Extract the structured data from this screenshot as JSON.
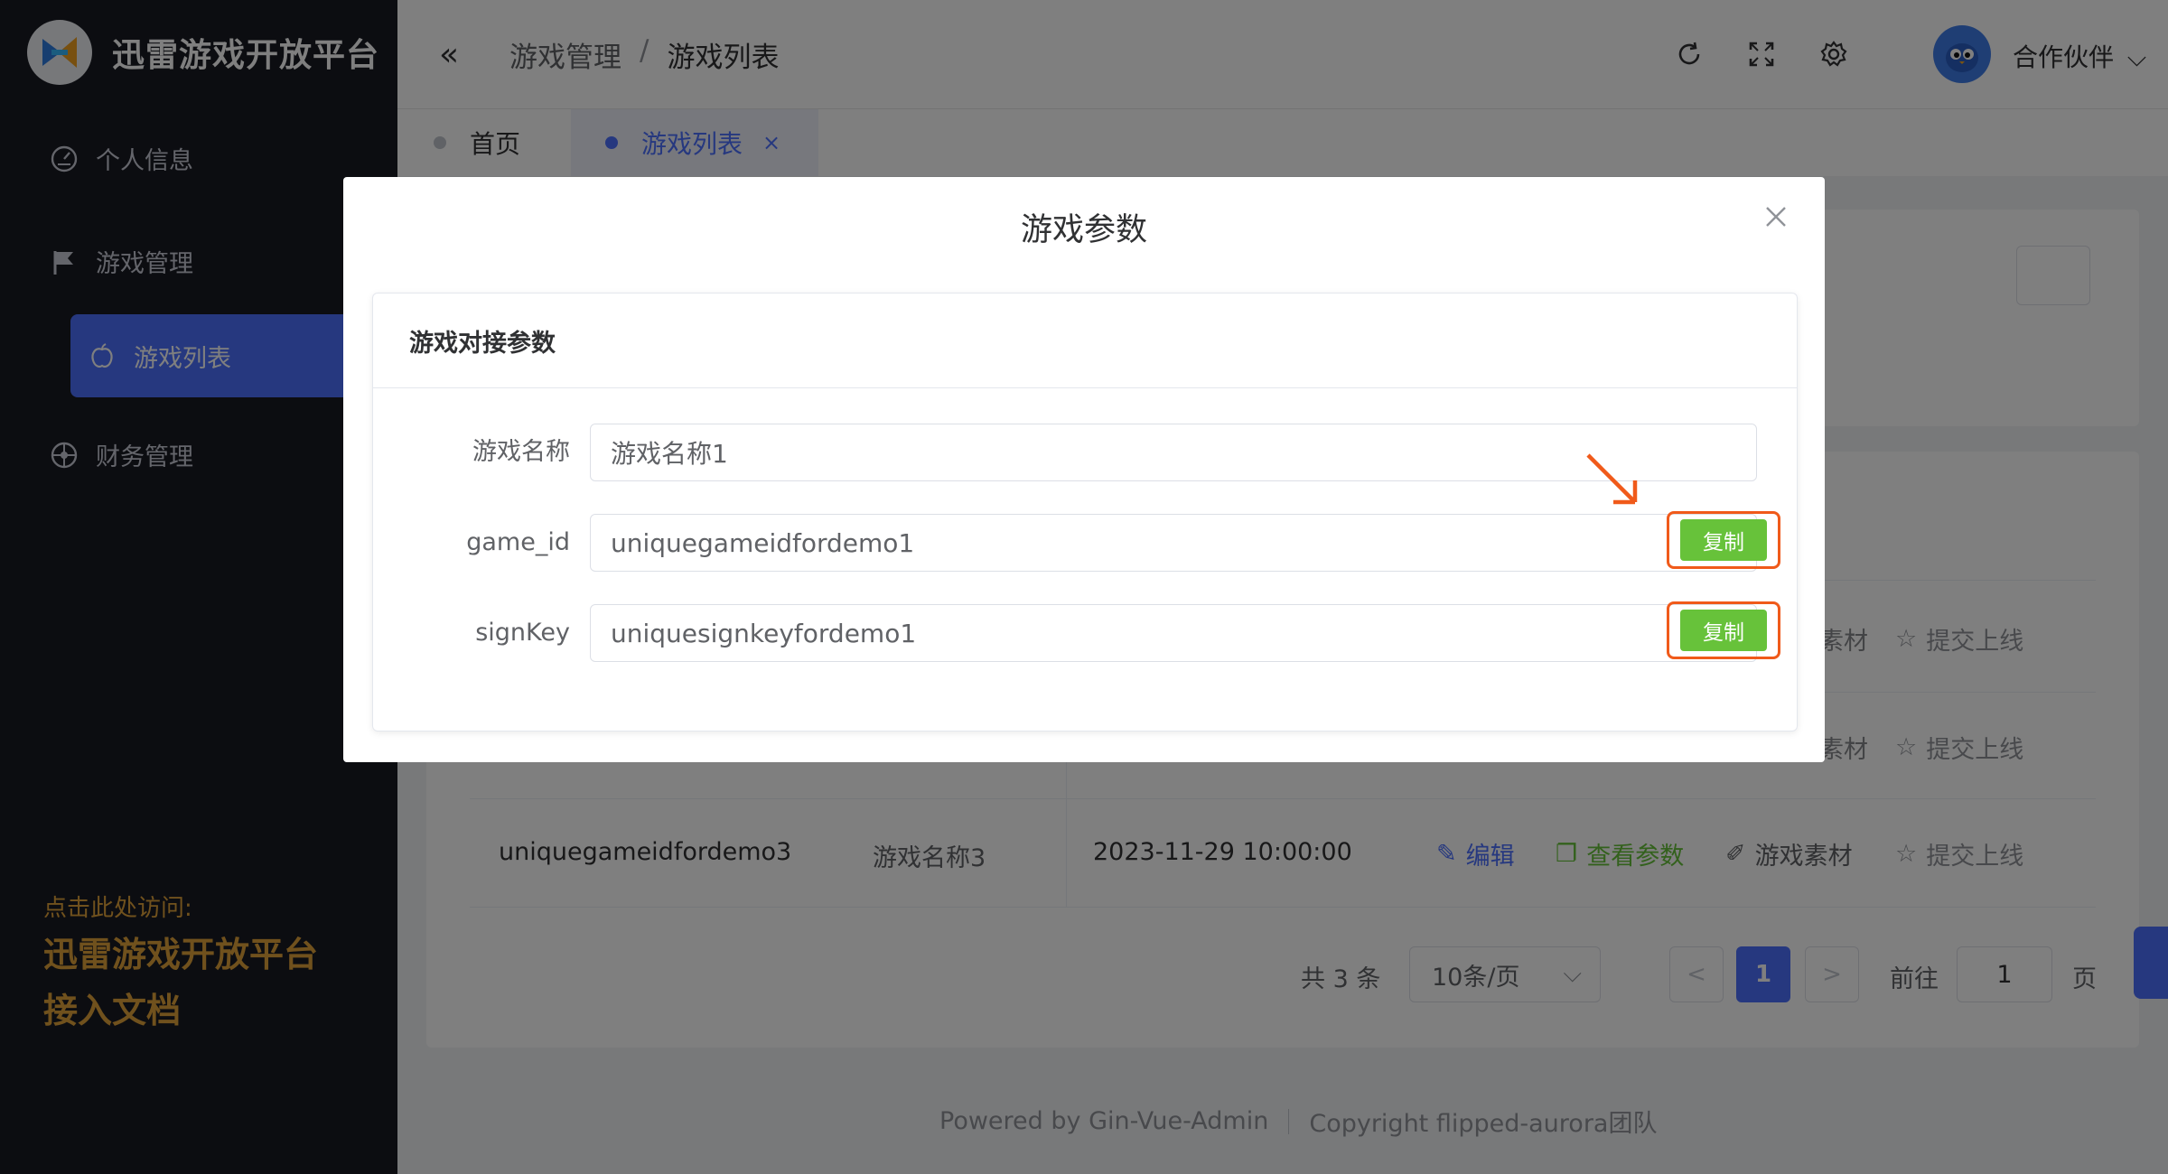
{
  "app": {
    "title": "迅雷游戏开放平台"
  },
  "sidebar": {
    "items": [
      {
        "label": "个人信息",
        "icon": "dashboard-icon"
      },
      {
        "label": "游戏管理",
        "icon": "flag-icon"
      },
      {
        "label": "游戏列表",
        "icon": "apple-icon",
        "active": true
      },
      {
        "label": "财务管理",
        "icon": "compass-icon"
      }
    ],
    "doc_hint": "点击此处访问:",
    "doc_title_line1": "迅雷游戏开放平台",
    "doc_title_line2": "接入文档"
  },
  "header": {
    "breadcrumb": [
      "游戏管理",
      "/",
      "游戏列表"
    ],
    "user_name": "合作伙伴"
  },
  "tabs": [
    {
      "label": "首页",
      "active": false
    },
    {
      "label": "游戏列表",
      "active": true,
      "close": "×"
    }
  ],
  "table": {
    "row_visible": {
      "game_id": "uniquegameidfordemo3",
      "game_name": "游戏名称3",
      "time": "2023-11-29 10:00:00"
    },
    "actions": {
      "edit": "编辑",
      "view_params": "查看参数",
      "materials": "游戏素材",
      "submit": "提交上线",
      "materials_partial": "素材"
    }
  },
  "pagination": {
    "total": "共 3 条",
    "page_size": "10条/页",
    "prev": "<",
    "current": "1",
    "next": ">",
    "goto_label": "前往",
    "goto_value": "1",
    "goto_unit": "页"
  },
  "footer": {
    "powered": "Powered by  Gin-Vue-Admin",
    "copyright": "Copyright  flipped-aurora团队"
  },
  "dialog": {
    "title": "游戏参数",
    "section_title": "游戏对接参数",
    "fields": [
      {
        "label": "游戏名称",
        "value": "游戏名称1",
        "copy": false
      },
      {
        "label": "game_id",
        "value": "uniquegameidfordemo1",
        "copy": true
      },
      {
        "label": "signKey",
        "value": "uniquesignkeyfordemo1",
        "copy": true
      }
    ],
    "copy_label": "复制"
  },
  "colors": {
    "sidebar_bg": "#191a23",
    "accent": "#4d70ff",
    "success": "#67c23a",
    "highlight": "#f05a1a",
    "doc_link": "#e0a23b"
  }
}
